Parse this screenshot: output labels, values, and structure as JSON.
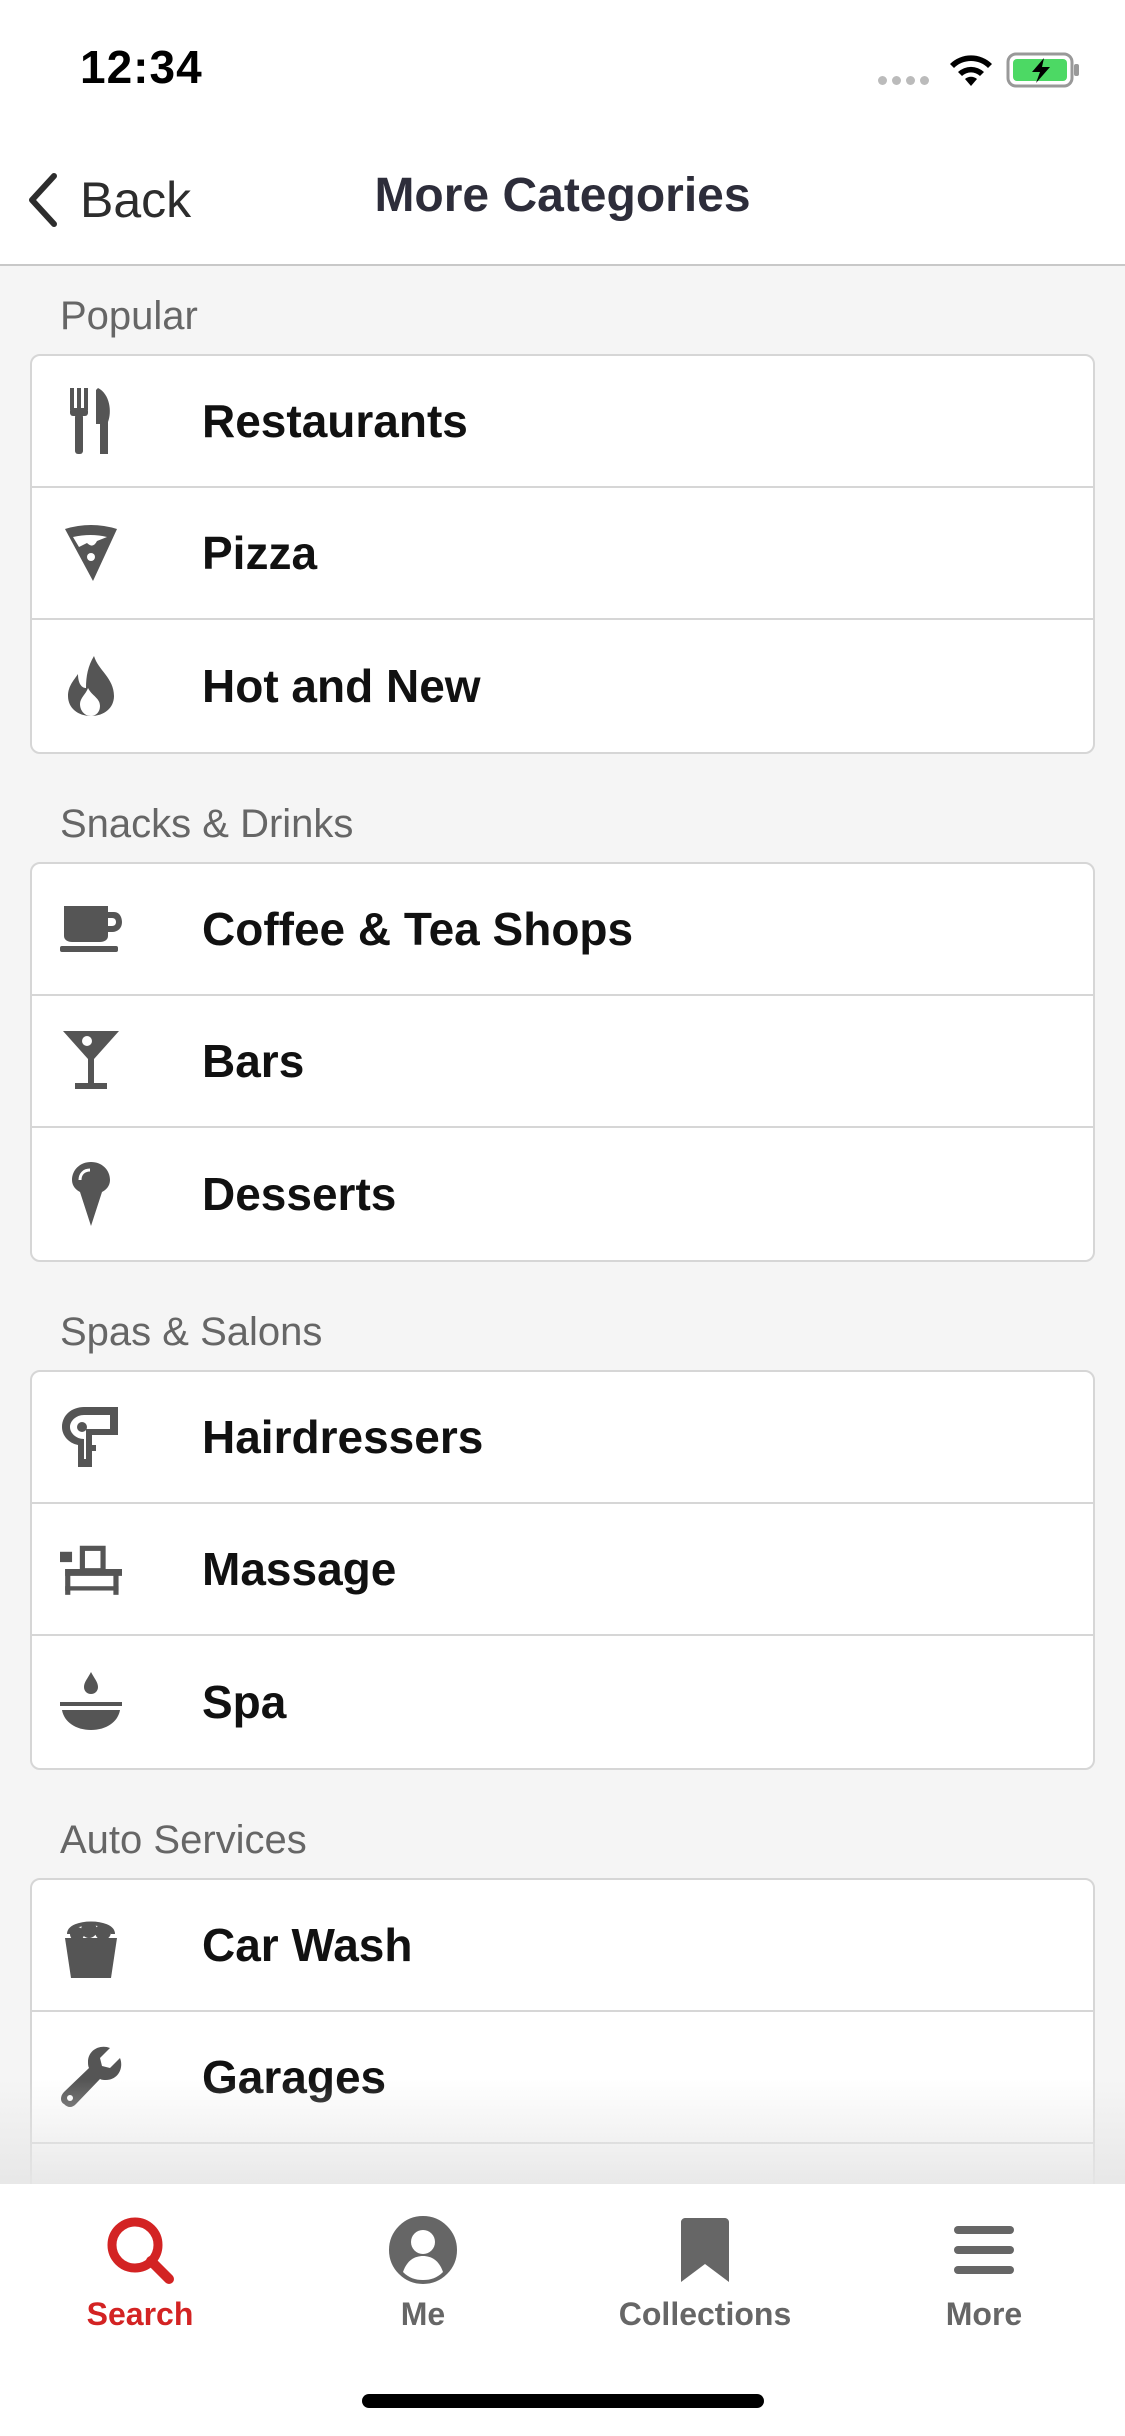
{
  "status": {
    "time": "12:34"
  },
  "nav": {
    "back_label": "Back",
    "title": "More Categories"
  },
  "sections": [
    {
      "header": "Popular",
      "items": [
        {
          "label": "Restaurants",
          "icon": "fork-knife-icon"
        },
        {
          "label": "Pizza",
          "icon": "pizza-icon"
        },
        {
          "label": "Hot and New",
          "icon": "flame-icon"
        }
      ]
    },
    {
      "header": "Snacks & Drinks",
      "items": [
        {
          "label": "Coffee & Tea Shops",
          "icon": "coffee-cup-icon"
        },
        {
          "label": "Bars",
          "icon": "cocktail-icon"
        },
        {
          "label": "Desserts",
          "icon": "ice-cream-icon"
        }
      ]
    },
    {
      "header": "Spas & Salons",
      "items": [
        {
          "label": "Hairdressers",
          "icon": "hair-dryer-icon"
        },
        {
          "label": "Massage",
          "icon": "massage-table-icon"
        },
        {
          "label": "Spa",
          "icon": "spa-bowl-icon"
        }
      ]
    },
    {
      "header": "Auto Services",
      "items": [
        {
          "label": "Car Wash",
          "icon": "bucket-icon"
        },
        {
          "label": "Garages",
          "icon": "wrench-icon"
        }
      ]
    }
  ],
  "tabs": [
    {
      "label": "Search",
      "icon": "search-icon",
      "active": true
    },
    {
      "label": "Me",
      "icon": "user-icon",
      "active": false
    },
    {
      "label": "Collections",
      "icon": "bookmark-icon",
      "active": false
    },
    {
      "label": "More",
      "icon": "menu-icon",
      "active": false
    }
  ],
  "colors": {
    "accent": "#d32323",
    "icon_gray": "#555555",
    "battery_green": "#4cd964"
  }
}
